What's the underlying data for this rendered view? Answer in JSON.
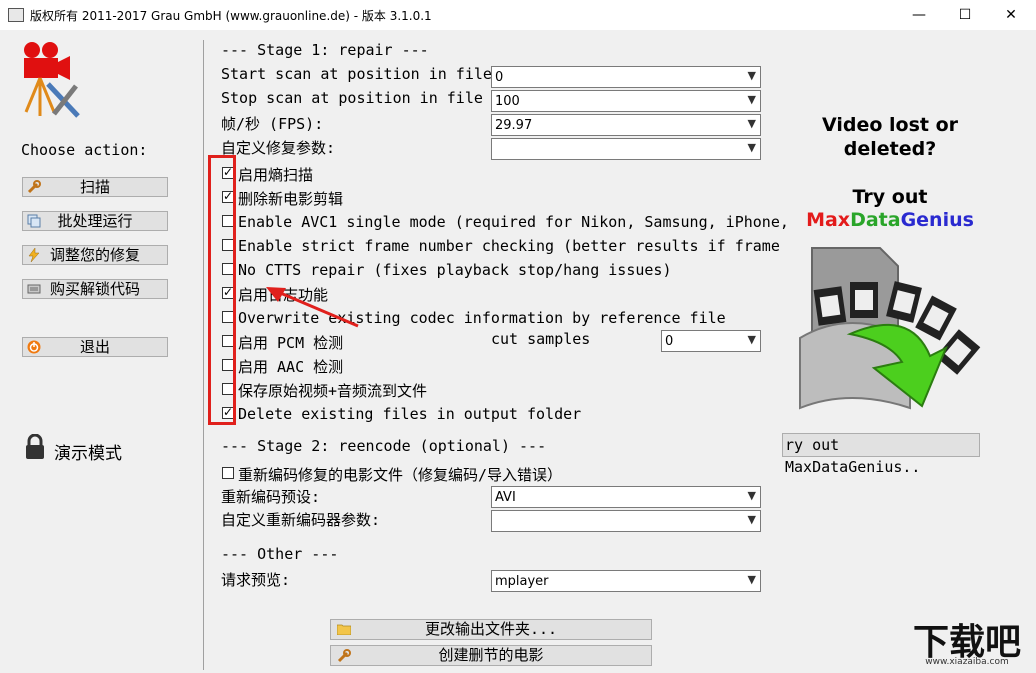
{
  "window": {
    "title": "版权所有 2011-2017 Grau GmbH (www.grauonline.de) - 版本 3.1.0.1",
    "minimize": "—",
    "maximize": "☐",
    "close": "✕"
  },
  "sidebar": {
    "choose_action": "Choose action:",
    "buttons": [
      {
        "label": "扫描",
        "icon": "wrench-icon"
      },
      {
        "label": "批处理运行",
        "icon": "batch-icon"
      },
      {
        "label": "调整您的修复",
        "icon": "lightning-icon"
      },
      {
        "label": "购买解锁代码",
        "icon": "cash-icon"
      },
      {
        "label": "退出",
        "icon": "power-icon"
      }
    ],
    "demo_mode": "演示模式"
  },
  "stage1": {
    "header": "--- Stage 1: repair ---",
    "start_scan_label": "Start scan at position in file",
    "start_scan_value": "0",
    "stop_scan_label": "Stop scan at position in file",
    "stop_scan_value": "100",
    "fps_label": "帧/秒 (FPS):",
    "fps_value": "29.97",
    "custom_params_label": "自定义修复参数:",
    "custom_params_value": "",
    "checkboxes": [
      {
        "label": "启用熵扫描",
        "checked": true
      },
      {
        "label": "删除新电影剪辑",
        "checked": true
      },
      {
        "label": "Enable AVC1 single mode (required for Nikon, Samsung, iPhone,",
        "checked": false
      },
      {
        "label": "Enable strict frame number checking (better results if frame",
        "checked": false
      },
      {
        "label": "No CTTS repair (fixes playback stop/hang issues)",
        "checked": false
      },
      {
        "label": "启用日志功能",
        "checked": true
      },
      {
        "label": "Overwrite existing codec information by reference file",
        "checked": false
      },
      {
        "label": "启用 PCM 检测",
        "checked": false
      },
      {
        "label": "启用 AAC 检测",
        "checked": false
      },
      {
        "label": "保存原始视频+音频流到文件",
        "checked": false
      },
      {
        "label": "Delete existing files in output folder",
        "checked": true
      }
    ],
    "cut_samples_label": "cut samples",
    "cut_samples_value": "0"
  },
  "stage2": {
    "header": "--- Stage 2: reencode (optional) ---",
    "reencode_label": "重新编码修复的电影文件（修复编码/导入错误）",
    "reencode_checked": false,
    "preset_label": "重新编码预设:",
    "preset_value": "AVI",
    "custom_encoder_label": "自定义重新编码器参数:",
    "custom_encoder_value": ""
  },
  "other": {
    "header": "--- Other ---",
    "preview_label": "请求预览:",
    "preview_value": "mplayer"
  },
  "bottom_buttons": {
    "change_output": "更改输出文件夹...",
    "create_cut_movie": "创建删节的电影"
  },
  "promo": {
    "line1": "Video lost or",
    "line2": "deleted?",
    "line3": "Try out",
    "brand_max": "Max",
    "brand_data": "Data",
    "brand_genius": "Genius",
    "button": "ry out MaxDataGenius.."
  },
  "watermark": {
    "logo_text": "下载吧",
    "url": "www.xiazaiba.com"
  },
  "colors": {
    "highlight_red": "#e0201c",
    "brand_red": "#e31b1b",
    "brand_green": "#2aa52a",
    "brand_blue": "#2a2ad0"
  }
}
